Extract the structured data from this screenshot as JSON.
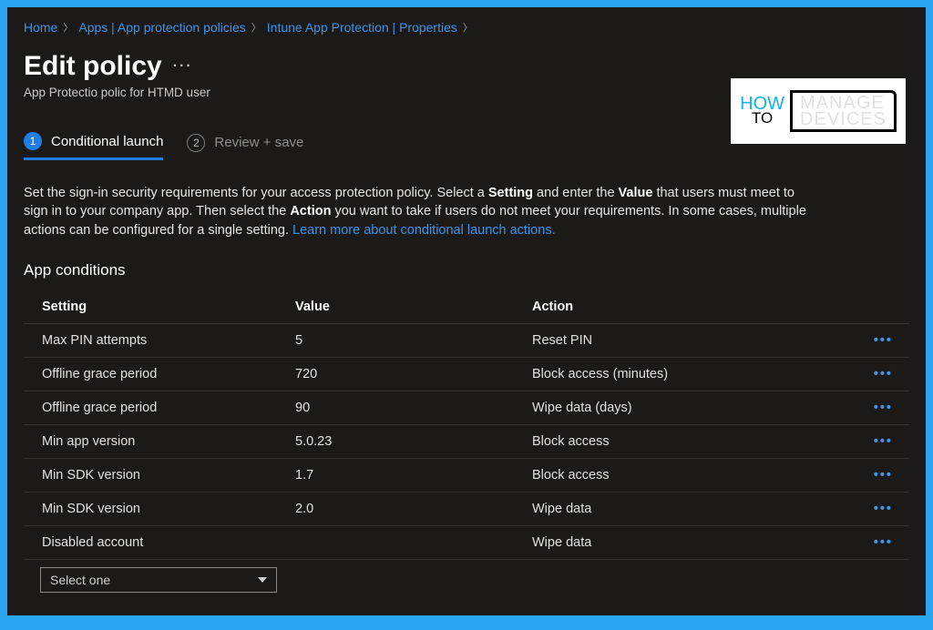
{
  "breadcrumb": {
    "home": "Home",
    "apps": "Apps | App protection policies",
    "intune": "Intune App Protection | Properties"
  },
  "header": {
    "title": "Edit policy",
    "subtitle": "App Protectio polic for HTMD user"
  },
  "watermark": {
    "how": "HOW",
    "to": "TO",
    "manage": "MANAGE",
    "devices": "DEVICES"
  },
  "tabs": {
    "step1_num": "1",
    "step1_label": "Conditional launch",
    "step2_num": "2",
    "step2_label": "Review + save"
  },
  "description": {
    "pre1": "Set the sign-in security requirements for your access protection policy. Select a ",
    "b1": "Setting",
    "mid1": " and enter the ",
    "b2": "Value",
    "mid2": " that users must meet to sign in to your company app. Then select the ",
    "b3": "Action",
    "post": " you want to take if users do not meet your requirements. In some cases, multiple actions can be configured for a single setting. ",
    "link": "Learn more about conditional launch actions."
  },
  "section_title": "App conditions",
  "columns": {
    "setting": "Setting",
    "value": "Value",
    "action": "Action"
  },
  "rows": [
    {
      "setting": "Max PIN attempts",
      "value": "5",
      "action": "Reset PIN"
    },
    {
      "setting": "Offline grace period",
      "value": "720",
      "action": "Block access (minutes)"
    },
    {
      "setting": "Offline grace period",
      "value": "90",
      "action": "Wipe data (days)"
    },
    {
      "setting": "Min app version",
      "value": "5.0.23",
      "action": "Block access"
    },
    {
      "setting": "Min SDK version",
      "value": "1.7",
      "action": "Block access"
    },
    {
      "setting": "Min SDK version",
      "value": "2.0",
      "action": "Wipe data"
    },
    {
      "setting": "Disabled account",
      "value": "",
      "action": "Wipe data"
    }
  ],
  "select_placeholder": "Select one"
}
